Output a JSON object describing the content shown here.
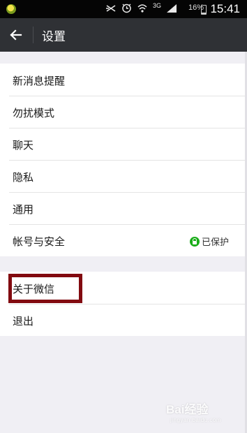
{
  "status_bar": {
    "app_icon": "wechat-notification-icon",
    "icons": [
      "muted-icon",
      "alarm-icon",
      "wifi-icon",
      "signal-icon"
    ],
    "network": "3G",
    "battery": "16%",
    "time": "15:41"
  },
  "header": {
    "title": "设置",
    "back_icon": "back-arrow-icon"
  },
  "settings": {
    "group1": [
      {
        "label": "新消息提醒"
      },
      {
        "label": "勿扰模式"
      },
      {
        "label": "聊天"
      },
      {
        "label": "隐私"
      },
      {
        "label": "通用"
      },
      {
        "label": "帐号与安全",
        "status": "已保护"
      }
    ],
    "group2": [
      {
        "label": "关于微信"
      },
      {
        "label": "退出"
      }
    ]
  },
  "colors": {
    "header_bg": "#2f3135",
    "highlight_border": "#820a10",
    "protect_green": "#1aad19"
  },
  "watermark": {
    "text": "Bai经验",
    "sub": "jingyan.baidu.com"
  }
}
